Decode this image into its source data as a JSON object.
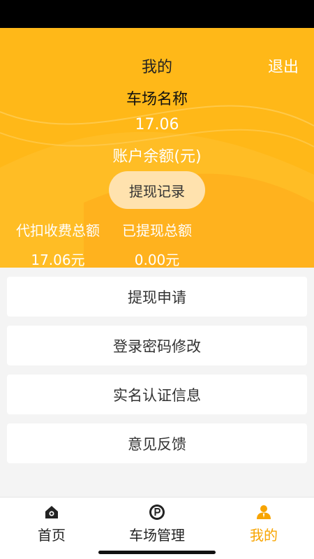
{
  "header": {
    "title": "我的",
    "logout_label": "退出",
    "lot_name": "车场名称",
    "balance": "17.06",
    "balance_label": "账户余额(元)",
    "record_button": "提现记录",
    "stats": [
      {
        "label": "代扣收费总额",
        "value": "17.06元"
      },
      {
        "label": "已提现总额",
        "value": "0.00元"
      }
    ]
  },
  "menu": {
    "items": [
      {
        "label": "提现申请"
      },
      {
        "label": "登录密码修改"
      },
      {
        "label": "实名认证信息"
      },
      {
        "label": "意见反馈"
      }
    ]
  },
  "tabbar": {
    "tabs": [
      {
        "label": "首页",
        "icon": "home-icon"
      },
      {
        "label": "车场管理",
        "icon": "parking-icon"
      },
      {
        "label": "我的",
        "icon": "user-icon",
        "active": true
      }
    ]
  },
  "colors": {
    "accent": "#ffb818",
    "active_tab": "#f7a400",
    "button_bg": "#ffe2ae"
  }
}
